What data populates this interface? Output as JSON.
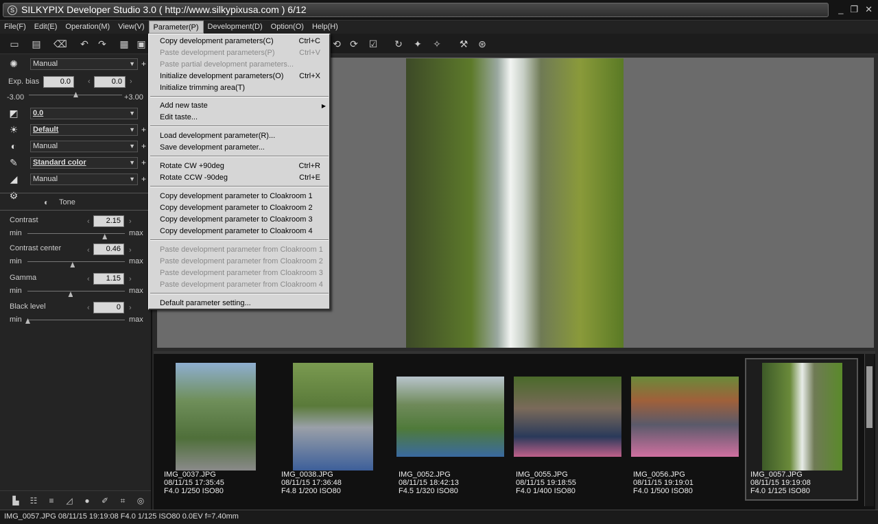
{
  "window": {
    "title": "SILKYPIX Developer Studio 3.0 ( http://www.silkypixusa.com )   6/12",
    "logo": "S",
    "min": "_",
    "max": "❐",
    "close": "✕"
  },
  "menubar": [
    "File(F)",
    "Edit(E)",
    "Operation(M)",
    "View(V)",
    "Parameter(P)",
    "Development(D)",
    "Option(O)",
    "Help(H)"
  ],
  "left": {
    "wb": "Manual",
    "exp_label": "Exp. bias",
    "exp_val1": "0.0",
    "exp_val2": "0.0",
    "exp_min": "-3.00",
    "exp_max": "+3.00",
    "exp_level": 0.5,
    "sel_tone": "0.0",
    "sel_taste": "Default",
    "sel_contrast": "Manual",
    "sel_color": "Standard color",
    "sel_sharp": "Manual",
    "tone_title": "Tone",
    "contrast_label": "Contrast",
    "contrast_val": "2.15",
    "contrast_level": 0.79,
    "center_label": "Contrast center",
    "center_val": "0.46",
    "center_level": 0.46,
    "gamma_label": "Gamma",
    "gamma_val": "1.15",
    "gamma_level": 0.44,
    "black_label": "Black level",
    "black_val": "0",
    "black_level": 0.0,
    "min": "min",
    "max": "max"
  },
  "menu": {
    "copy": "Copy development parameters(C)",
    "copy_sc": "Ctrl+C",
    "paste": "Paste development parameters(P)",
    "paste_sc": "Ctrl+V",
    "paste_partial": "Paste partial development parameters...",
    "init": "Initialize development parameters(O)",
    "init_sc": "Ctrl+X",
    "init_trim": "Initialize trimming area(T)",
    "add_taste": "Add new taste",
    "edit_taste": "Edit taste...",
    "load": "Load development parameter(R)...",
    "save": "Save development parameter...",
    "rot_cw": "Rotate CW +90deg",
    "rot_cw_sc": "Ctrl+R",
    "rot_ccw": "Rotate CCW -90deg",
    "rot_ccw_sc": "Ctrl+E",
    "copy_c1": "Copy development parameter to Cloakroom 1",
    "copy_c2": "Copy development parameter to Cloakroom 2",
    "copy_c3": "Copy development parameter to Cloakroom 3",
    "copy_c4": "Copy development parameter to Cloakroom 4",
    "paste_c1": "Paste development parameter from Cloakroom 1",
    "paste_c2": "Paste development parameter from Cloakroom 2",
    "paste_c3": "Paste development parameter from Cloakroom 3",
    "paste_c4": "Paste development parameter from Cloakroom 4",
    "default": "Default parameter setting..."
  },
  "thumbs": [
    {
      "name": "IMG_0037.JPG",
      "date": "08/11/15 17:35:45",
      "exif": "F4.0 1/250 ISO80"
    },
    {
      "name": "IMG_0038.JPG",
      "date": "08/11/15 17:36:48",
      "exif": "F4.8 1/200 ISO80"
    },
    {
      "name": "IMG_0052.JPG",
      "date": "08/11/15 18:42:13",
      "exif": "F4.5 1/320 ISO80"
    },
    {
      "name": "IMG_0055.JPG",
      "date": "08/11/15 19:18:55",
      "exif": "F4.0 1/400 ISO80"
    },
    {
      "name": "IMG_0056.JPG",
      "date": "08/11/15 19:19:01",
      "exif": "F4.0 1/500 ISO80"
    },
    {
      "name": "IMG_0057.JPG",
      "date": "08/11/15 19:19:08",
      "exif": "F4.0 1/125 ISO80"
    }
  ],
  "status": "IMG_0057.JPG 08/11/15 19:19:08 F4.0 1/125 ISO80  0.0EV f=7.40mm"
}
